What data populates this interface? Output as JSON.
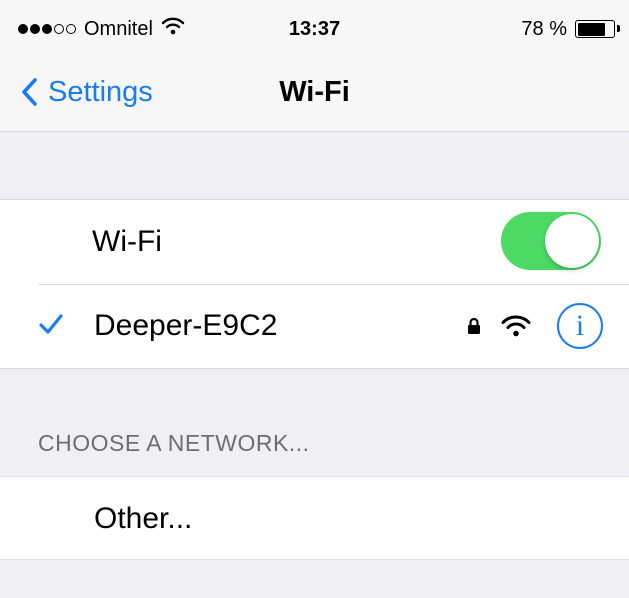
{
  "status_bar": {
    "signal_bars_filled": 3,
    "signal_bars_total": 5,
    "carrier": "Omnitel",
    "time": "13:37",
    "battery_percent": "78 %",
    "battery_level": 0.78
  },
  "nav": {
    "back_label": "Settings",
    "title": "Wi-Fi"
  },
  "wifi_toggle": {
    "label": "Wi-Fi",
    "on": true,
    "color": "#4cd964"
  },
  "connected_network": {
    "name": "Deeper-E9C2",
    "secured": true,
    "info_label": "i"
  },
  "choose_section": {
    "header": "CHOOSE A NETWORK..."
  },
  "other_row": {
    "label": "Other..."
  },
  "colors": {
    "accent": "#1a7cf2",
    "toggle_on": "#4cd964",
    "background": "#efeff4"
  }
}
